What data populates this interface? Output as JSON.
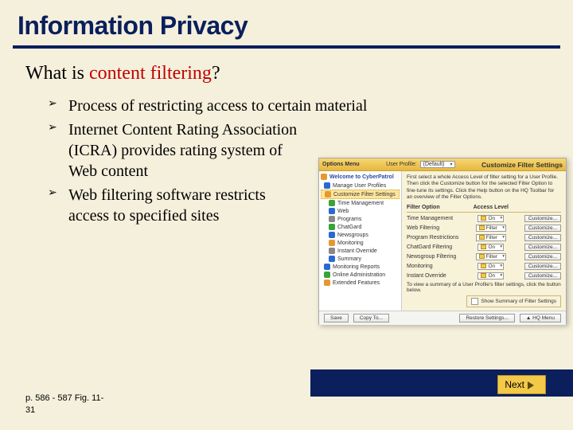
{
  "slide": {
    "title": "Information Privacy",
    "question_pre": "What is ",
    "question_hl": "content filtering",
    "question_post": "?",
    "bullets": [
      "Process of restricting access to certain material",
      "Internet Content Rating Association (ICRA) provides rating system of Web content",
      "Web filtering software restricts access to specified sites"
    ],
    "footer_l1": "p. 586 - 587 Fig. 11-",
    "footer_l2": "31",
    "next": "Next"
  },
  "app": {
    "options_label": "Options Menu",
    "profile_label": "User Profile:",
    "profile_value": "(Default)",
    "panel_title": "Customize Filter Settings",
    "welcome": "Welcome to CyberPatrol",
    "tree": [
      {
        "label": "Manage User Profiles",
        "cls": "ic-blue"
      },
      {
        "label": "Customize Filter Settings",
        "cls": "ic-orange",
        "sel": true
      },
      {
        "label": "Time Management",
        "cls": "ic-green"
      },
      {
        "label": "Web",
        "cls": "ic-blue"
      },
      {
        "label": "Programs",
        "cls": "ic-grey"
      },
      {
        "label": "ChatGard",
        "cls": "ic-green"
      },
      {
        "label": "Newsgroups",
        "cls": "ic-blue"
      },
      {
        "label": "Monitoring",
        "cls": "ic-orange"
      },
      {
        "label": "Instant Override",
        "cls": "ic-grey"
      },
      {
        "label": "Summary",
        "cls": "ic-blue"
      },
      {
        "label": "Monitoring Reports",
        "cls": "ic-blue"
      },
      {
        "label": "Online Administration",
        "cls": "ic-green"
      },
      {
        "label": "Extended Features",
        "cls": "ic-orange"
      }
    ],
    "intro": "First select a whole Access Level of filter setting for a User Profile. Then click the Customize button for the selected Filter Option to fine-tune its settings. Click the Help button on the HQ Toolbar for an overview of the Filter Options.",
    "col1": "Filter Option",
    "col2": "Access Level",
    "rows": [
      {
        "opt": "Time Management",
        "lvl": "On",
        "btn": "Customize..."
      },
      {
        "opt": "Web Filtering",
        "lvl": "Filter",
        "btn": "Customize..."
      },
      {
        "opt": "Program Restrictions",
        "lvl": "Filter",
        "btn": "Customize..."
      },
      {
        "opt": "ChatGard Filtering",
        "lvl": "On",
        "btn": "Customize..."
      },
      {
        "opt": "Newsgroup Filtering",
        "lvl": "Filter",
        "btn": "Customize..."
      },
      {
        "opt": "Monitoring",
        "lvl": "On",
        "btn": "Customize..."
      },
      {
        "opt": "Instant Override",
        "lvl": "On",
        "btn": "Customize..."
      }
    ],
    "note": "To view a summary of a User Profile's filter settings, click the button below.",
    "summary_btn": "Show Summary of Filter Settings",
    "btn_save": "Save",
    "btn_copy": "Copy To...",
    "btn_restore": "Restore Settings...",
    "btn_hq": "HQ Menu"
  }
}
